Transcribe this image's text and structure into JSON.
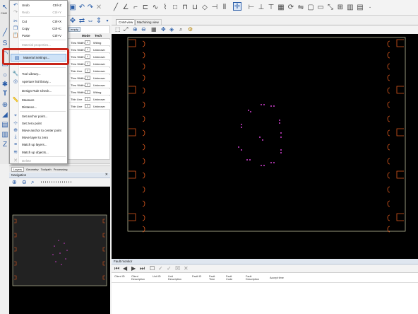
{
  "app_label": "CAM",
  "menu": {
    "items": [
      {
        "label": "Undo",
        "shortcut": "Ctrl+Z",
        "icon": "undo-icon",
        "disabled": false
      },
      {
        "label": "Redo",
        "shortcut": "Ctrl+Y",
        "icon": "redo-icon",
        "disabled": true
      },
      {
        "label": "Cut",
        "shortcut": "Ctrl+X",
        "icon": "cut-icon",
        "disabled": false
      },
      {
        "label": "Copy",
        "shortcut": "Ctrl+C",
        "icon": "copy-icon",
        "disabled": false
      },
      {
        "label": "Paste",
        "shortcut": "Ctrl+V",
        "icon": "paste-icon",
        "disabled": false
      },
      {
        "label": "Material properties...",
        "shortcut": "",
        "icon": "",
        "disabled": true
      },
      {
        "label": "Material Settings...",
        "shortcut": "",
        "icon": "material-settings-icon",
        "disabled": false
      },
      {
        "label": "Tool Library...",
        "shortcut": "",
        "icon": "tool-library-icon",
        "disabled": false
      },
      {
        "label": "Aperture list library...",
        "shortcut": "",
        "icon": "aperture-icon",
        "disabled": false
      },
      {
        "label": "Design Rule Check...",
        "shortcut": "",
        "icon": "",
        "disabled": false
      },
      {
        "label": "Measure",
        "shortcut": "",
        "icon": "measure-icon",
        "disabled": false
      },
      {
        "label": "Distance...",
        "shortcut": "",
        "icon": "",
        "disabled": false
      },
      {
        "label": "Set anchor point...",
        "shortcut": "",
        "icon": "anchor-icon",
        "disabled": false
      },
      {
        "label": "Set zero point",
        "shortcut": "",
        "icon": "zero-point-icon",
        "disabled": false
      },
      {
        "label": "Move anchor to center point",
        "shortcut": "",
        "icon": "anchor-center-icon",
        "disabled": false
      },
      {
        "label": "Move layer to zero",
        "shortcut": "",
        "icon": "layer-zero-icon",
        "disabled": false
      },
      {
        "label": "Match up layers...",
        "shortcut": "",
        "icon": "match-layers-icon",
        "disabled": false
      },
      {
        "label": "Match up objects...",
        "shortcut": "",
        "icon": "match-objects-icon",
        "disabled": false
      },
      {
        "label": "Delete",
        "shortcut": "",
        "icon": "delete-icon",
        "disabled": true
      }
    ]
  },
  "layer_table": {
    "header_extra": "empty",
    "columns": [
      "Mode",
      "Tech"
    ],
    "rows": [
      {
        "mode": "Thru Width",
        "tech": "Wiring"
      },
      {
        "mode": "Thru Width",
        "tech": "Unknown"
      },
      {
        "mode": "Thru Width",
        "tech": "Unknown"
      },
      {
        "mode": "Thru Width",
        "tech": "Unknown"
      },
      {
        "mode": "Thin Line",
        "tech": "Unknown"
      },
      {
        "mode": "Thru Width",
        "tech": "Unknown"
      },
      {
        "mode": "Thru Width",
        "tech": "Unknown"
      },
      {
        "mode": "Thru Width",
        "tech": "Wiring"
      },
      {
        "mode": "Thin Line",
        "tech": "Unknown"
      },
      {
        "mode": "Thin Line",
        "tech": "Unknown"
      }
    ]
  },
  "bottom_tabs": [
    "Layers",
    "Geometry",
    "Toolpath",
    "Processing"
  ],
  "navigation_title": "Navigation",
  "view_tabs": [
    "CAM view",
    "Machining view"
  ],
  "fault_monitor": {
    "title": "Fault monitor",
    "columns": [
      "Client ID",
      "Client Description",
      "Unit ID",
      "Unit Description",
      "Fault ID",
      "Fault Time",
      "Fault Code",
      "Fault Description",
      "Accept time"
    ]
  },
  "colors": {
    "highlight": "#c8251a",
    "board_outline": "#d8d8b0",
    "pads": "#e05a1e",
    "holes": "#d040d0",
    "accent": "#2a5da8"
  }
}
